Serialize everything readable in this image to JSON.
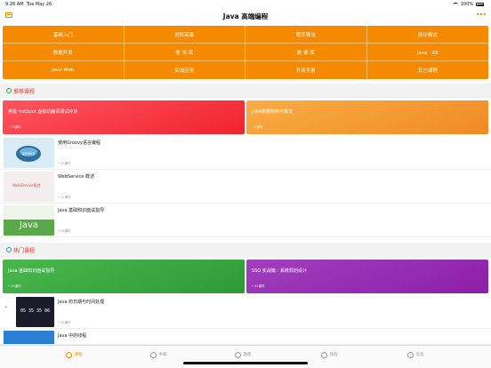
{
  "status": {
    "time": "9:28 AM",
    "date": "Tue May 26",
    "battery": "100%"
  },
  "nav": {
    "title": "Java 高端编程"
  },
  "categories": [
    "基础入门",
    "进阶高级",
    "程序算法",
    "设计模式",
    "数据开发",
    "常 用 库",
    "数 据 库",
    "Java　EE",
    "Java Web",
    "实战应用",
    "开发手册",
    "其它课程"
  ],
  "recommend": {
    "title": "推荐课程",
    "banners": [
      {
        "title": "搭建 HotSpot 虚拟机编译调试环境",
        "count": "• 13课时",
        "color_from": "#ff5560",
        "color_to": "#f0232e"
      },
      {
        "title": "JAVA数据结构与算法",
        "count": "• 7课时",
        "color_from": "#f9ad46",
        "color_to": "#f08a23"
      }
    ],
    "courses": [
      {
        "title": "使用Groovy语言编程",
        "count": "• 23课时",
        "thumb_color": "#d9ecf6",
        "thumb_text": ""
      },
      {
        "title": "WebService 概述",
        "count": "• 12课时",
        "thumb_color": "#f5eeee",
        "thumb_text": "WebService简述"
      },
      {
        "title": "Java 基础知识面试指导",
        "count": "• 30课时",
        "thumb_color": "#5aa84a",
        "thumb_text": "Java"
      }
    ]
  },
  "hot": {
    "title": "热门课程",
    "banners": [
      {
        "title": "Java 基础知识面试指导",
        "count": "• 30课时",
        "color_from": "#48b84c",
        "color_to": "#2e9a37"
      },
      {
        "title": "SSO 实战篇：系统规划设计",
        "count": "• 41课时",
        "color_from": "#a23fbf",
        "color_to": "#8b1fa7"
      }
    ],
    "courses": [
      {
        "title": "Java 的日期与时间处理",
        "count": "• 33课时",
        "thumb_color": "#1b1b2a",
        "thumb_text": "05 35 35 06"
      },
      {
        "title": "Java 中的线程",
        "count": "",
        "thumb_color": "#2b7fd2",
        "thumb_text": ""
      }
    ]
  },
  "tabs": [
    {
      "label": "课程",
      "active": true
    },
    {
      "label": "手册",
      "active": false
    },
    {
      "label": "题库",
      "active": false
    },
    {
      "label": "我的",
      "active": false
    },
    {
      "label": "信息",
      "active": false
    }
  ]
}
